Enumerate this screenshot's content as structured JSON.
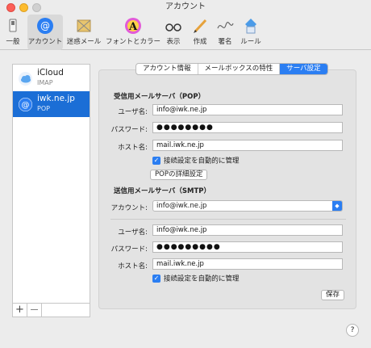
{
  "window": {
    "title": "アカウント"
  },
  "toolbar": {
    "items": [
      {
        "label": "一般",
        "icon": "switch-icon"
      },
      {
        "label": "アカウント",
        "icon": "at-icon"
      },
      {
        "label": "迷惑メール",
        "icon": "junk-mail-icon"
      },
      {
        "label": "フォントとカラー",
        "icon": "fonts-colors-icon"
      },
      {
        "label": "表示",
        "icon": "glasses-icon"
      },
      {
        "label": "作成",
        "icon": "pencil-icon"
      },
      {
        "label": "署名",
        "icon": "signature-icon"
      },
      {
        "label": "ルール",
        "icon": "rules-icon"
      }
    ]
  },
  "accounts": [
    {
      "name": "iCloud",
      "type": "IMAP",
      "icon": "cloud-icon"
    },
    {
      "name": "iwk.ne.jp",
      "type": "POP",
      "icon": "at-icon"
    }
  ],
  "sidebar_footer": {
    "add": "+",
    "remove": "—"
  },
  "tabs": [
    "アカウント情報",
    "メールボックスの特性",
    "サーバ設定"
  ],
  "incoming": {
    "title": "受信用メールサーバ（POP）",
    "username_label": "ユーザ名:",
    "username": "info@iwk.ne.jp",
    "password_label": "パスワード:",
    "password": "●●●●●●●●",
    "host_label": "ホスト名:",
    "host": "mail.iwk.ne.jp",
    "auto_manage": "接続設定を自動的に管理",
    "details_button": "POPの詳細設定"
  },
  "outgoing": {
    "title": "送信用メールサーバ（SMTP）",
    "account_label": "アカウント:",
    "account": "info@iwk.ne.jp",
    "username_label": "ユーザ名:",
    "username": "info@iwk.ne.jp",
    "password_label": "パスワード:",
    "password": "●●●●●●●●●",
    "host_label": "ホスト名:",
    "host": "mail.iwk.ne.jp",
    "auto_manage": "接続設定を自動的に管理"
  },
  "save_button": "保存",
  "help": "?",
  "colors": {
    "accent": "#2b7ef2",
    "selected_row": "#1b6ed6"
  }
}
